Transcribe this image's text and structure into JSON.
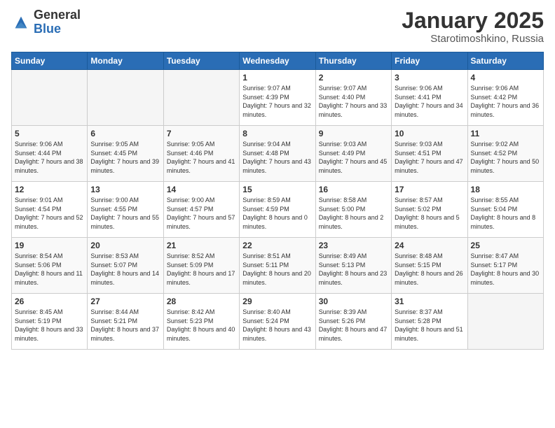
{
  "header": {
    "logo": {
      "general": "General",
      "blue": "Blue"
    },
    "title": "January 2025",
    "subtitle": "Starotimoshkino, Russia"
  },
  "weekdays": [
    "Sunday",
    "Monday",
    "Tuesday",
    "Wednesday",
    "Thursday",
    "Friday",
    "Saturday"
  ],
  "weeks": [
    [
      {
        "day": "",
        "sunrise": "",
        "sunset": "",
        "daylight": "",
        "empty": true
      },
      {
        "day": "",
        "sunrise": "",
        "sunset": "",
        "daylight": "",
        "empty": true
      },
      {
        "day": "",
        "sunrise": "",
        "sunset": "",
        "daylight": "",
        "empty": true
      },
      {
        "day": "1",
        "sunrise": "9:07 AM",
        "sunset": "4:39 PM",
        "daylight": "7 hours and 32 minutes."
      },
      {
        "day": "2",
        "sunrise": "9:07 AM",
        "sunset": "4:40 PM",
        "daylight": "7 hours and 33 minutes."
      },
      {
        "day": "3",
        "sunrise": "9:06 AM",
        "sunset": "4:41 PM",
        "daylight": "7 hours and 34 minutes."
      },
      {
        "day": "4",
        "sunrise": "9:06 AM",
        "sunset": "4:42 PM",
        "daylight": "7 hours and 36 minutes."
      }
    ],
    [
      {
        "day": "5",
        "sunrise": "9:06 AM",
        "sunset": "4:44 PM",
        "daylight": "7 hours and 38 minutes."
      },
      {
        "day": "6",
        "sunrise": "9:05 AM",
        "sunset": "4:45 PM",
        "daylight": "7 hours and 39 minutes."
      },
      {
        "day": "7",
        "sunrise": "9:05 AM",
        "sunset": "4:46 PM",
        "daylight": "7 hours and 41 minutes."
      },
      {
        "day": "8",
        "sunrise": "9:04 AM",
        "sunset": "4:48 PM",
        "daylight": "7 hours and 43 minutes."
      },
      {
        "day": "9",
        "sunrise": "9:03 AM",
        "sunset": "4:49 PM",
        "daylight": "7 hours and 45 minutes."
      },
      {
        "day": "10",
        "sunrise": "9:03 AM",
        "sunset": "4:51 PM",
        "daylight": "7 hours and 47 minutes."
      },
      {
        "day": "11",
        "sunrise": "9:02 AM",
        "sunset": "4:52 PM",
        "daylight": "7 hours and 50 minutes."
      }
    ],
    [
      {
        "day": "12",
        "sunrise": "9:01 AM",
        "sunset": "4:54 PM",
        "daylight": "7 hours and 52 minutes."
      },
      {
        "day": "13",
        "sunrise": "9:00 AM",
        "sunset": "4:55 PM",
        "daylight": "7 hours and 55 minutes."
      },
      {
        "day": "14",
        "sunrise": "9:00 AM",
        "sunset": "4:57 PM",
        "daylight": "7 hours and 57 minutes."
      },
      {
        "day": "15",
        "sunrise": "8:59 AM",
        "sunset": "4:59 PM",
        "daylight": "8 hours and 0 minutes."
      },
      {
        "day": "16",
        "sunrise": "8:58 AM",
        "sunset": "5:00 PM",
        "daylight": "8 hours and 2 minutes."
      },
      {
        "day": "17",
        "sunrise": "8:57 AM",
        "sunset": "5:02 PM",
        "daylight": "8 hours and 5 minutes."
      },
      {
        "day": "18",
        "sunrise": "8:55 AM",
        "sunset": "5:04 PM",
        "daylight": "8 hours and 8 minutes."
      }
    ],
    [
      {
        "day": "19",
        "sunrise": "8:54 AM",
        "sunset": "5:06 PM",
        "daylight": "8 hours and 11 minutes."
      },
      {
        "day": "20",
        "sunrise": "8:53 AM",
        "sunset": "5:07 PM",
        "daylight": "8 hours and 14 minutes."
      },
      {
        "day": "21",
        "sunrise": "8:52 AM",
        "sunset": "5:09 PM",
        "daylight": "8 hours and 17 minutes."
      },
      {
        "day": "22",
        "sunrise": "8:51 AM",
        "sunset": "5:11 PM",
        "daylight": "8 hours and 20 minutes."
      },
      {
        "day": "23",
        "sunrise": "8:49 AM",
        "sunset": "5:13 PM",
        "daylight": "8 hours and 23 minutes."
      },
      {
        "day": "24",
        "sunrise": "8:48 AM",
        "sunset": "5:15 PM",
        "daylight": "8 hours and 26 minutes."
      },
      {
        "day": "25",
        "sunrise": "8:47 AM",
        "sunset": "5:17 PM",
        "daylight": "8 hours and 30 minutes."
      }
    ],
    [
      {
        "day": "26",
        "sunrise": "8:45 AM",
        "sunset": "5:19 PM",
        "daylight": "8 hours and 33 minutes."
      },
      {
        "day": "27",
        "sunrise": "8:44 AM",
        "sunset": "5:21 PM",
        "daylight": "8 hours and 37 minutes."
      },
      {
        "day": "28",
        "sunrise": "8:42 AM",
        "sunset": "5:23 PM",
        "daylight": "8 hours and 40 minutes."
      },
      {
        "day": "29",
        "sunrise": "8:40 AM",
        "sunset": "5:24 PM",
        "daylight": "8 hours and 43 minutes."
      },
      {
        "day": "30",
        "sunrise": "8:39 AM",
        "sunset": "5:26 PM",
        "daylight": "8 hours and 47 minutes."
      },
      {
        "day": "31",
        "sunrise": "8:37 AM",
        "sunset": "5:28 PM",
        "daylight": "8 hours and 51 minutes."
      },
      {
        "day": "",
        "sunrise": "",
        "sunset": "",
        "daylight": "",
        "empty": true
      }
    ]
  ]
}
